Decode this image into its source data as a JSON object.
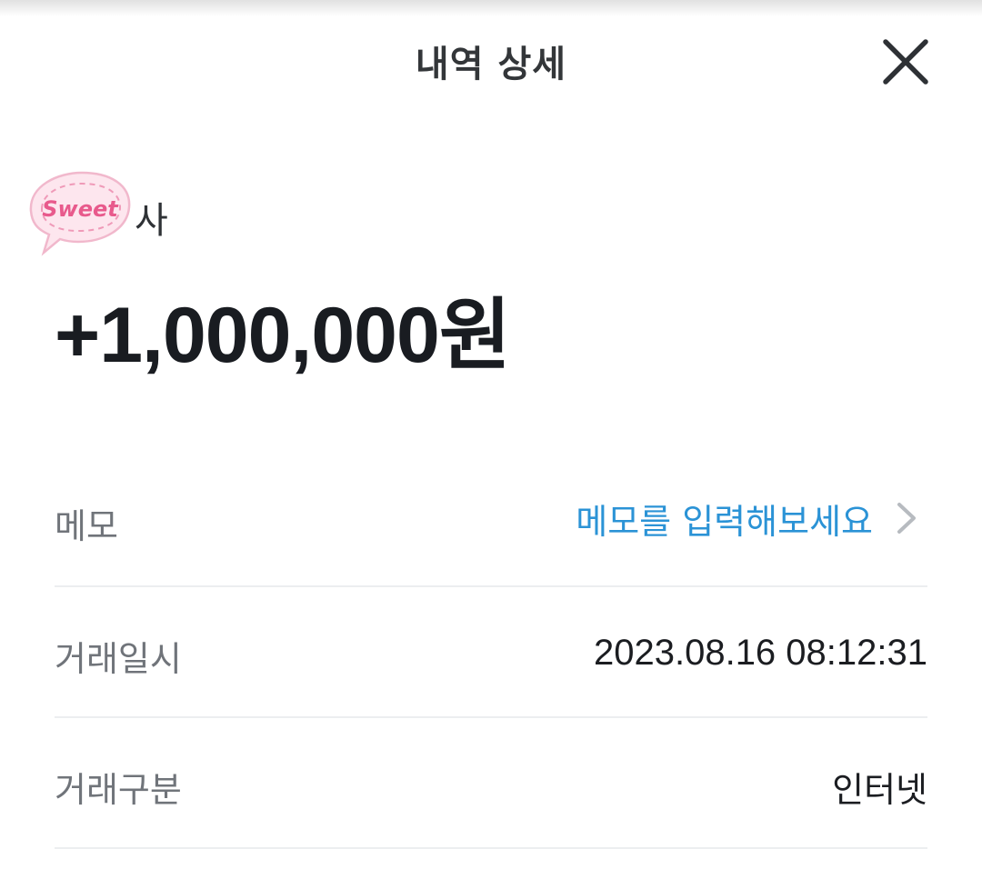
{
  "header": {
    "title": "내역 상세",
    "close_icon": "close-icon"
  },
  "transaction": {
    "sender_sticker_text": "Sweet",
    "sender_suffix": "사",
    "amount": "+1,000,000원"
  },
  "details": {
    "memo": {
      "label": "메모",
      "placeholder_link": "메모를 입력해보세요",
      "icon": "chevron-right-icon"
    },
    "datetime": {
      "label": "거래일시",
      "value": "2023.08.16 08:12:31"
    },
    "type": {
      "label": "거래구분",
      "value": "인터넷"
    }
  },
  "colors": {
    "link": "#2b93d6",
    "label": "#70747a",
    "text": "#1b1d21",
    "divider": "#eceef0",
    "sticker_fill": "#fde6ee",
    "sticker_text": "#e85a8c"
  }
}
